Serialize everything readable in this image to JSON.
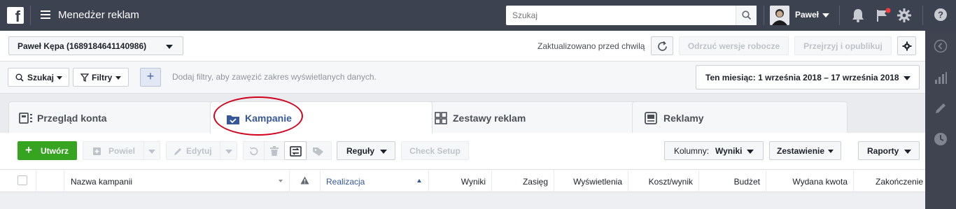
{
  "topbar": {
    "logo": "f",
    "title": "Menedżer reklam",
    "search_placeholder": "Szukaj",
    "user_name": "Paweł",
    "icons": [
      "menu-icon",
      "search-icon",
      "bell-icon",
      "flag-icon",
      "gear-icon",
      "help-icon"
    ]
  },
  "account": {
    "selected": "Paweł Kępa (1689184641140986)",
    "updated": "Zaktualizowano przed chwilą",
    "discard_label": "Odrzuć wersje robocze",
    "review_label": "Przejrzyj i opublikuj"
  },
  "filters": {
    "search_label": "Szukaj",
    "filters_label": "Filtry",
    "hint": "Dodaj filtry, aby zawęzić zakres wyświetlanych danych.",
    "date_range": "Ten miesiąc: 1 września 2018 – 17 września 2018"
  },
  "tabs": [
    {
      "label": "Przegląd konta"
    },
    {
      "label": "Kampanie"
    },
    {
      "label": "Zestawy reklam"
    },
    {
      "label": "Reklamy"
    }
  ],
  "toolbar": {
    "create_label": "Utwórz",
    "duplicate_label": "Powiel",
    "edit_label": "Edytuj",
    "rules_label": "Reguły",
    "check_setup_label": "Check Setup",
    "columns_prefix": "Kolumny:",
    "columns_value": "Wyniki",
    "breakdown_label": "Zestawienie",
    "reports_label": "Raporty"
  },
  "table": {
    "columns": [
      "Nazwa kampanii",
      "Realizacja",
      "Wyniki",
      "Zasięg",
      "Wyświetlenia",
      "Koszt/wynik",
      "Budżet",
      "Wydana kwota",
      "Zakończenie"
    ]
  },
  "colors": {
    "topbar": "#3c4250",
    "accent": "#365899",
    "create": "#36a420",
    "annotation": "#d0021b"
  }
}
